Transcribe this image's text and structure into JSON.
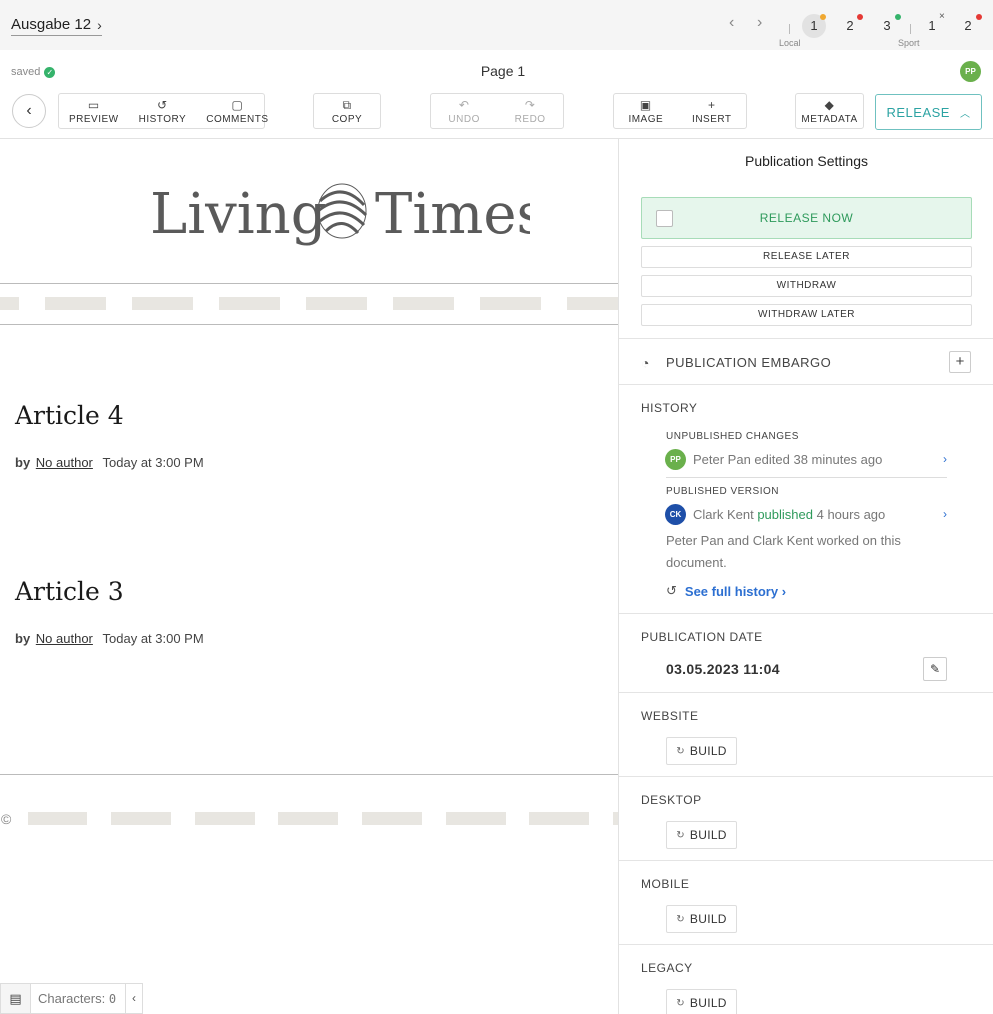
{
  "topbar": {
    "issue_label": "Ausgabe 12",
    "pages": [
      {
        "label": "1",
        "group": "Local",
        "status_color": "#f0a830",
        "active": true
      },
      {
        "label": "2",
        "group": "Local",
        "status_color": "#e53935"
      },
      {
        "label": "3",
        "group": "Sport",
        "status_color": "#35b36b"
      },
      {
        "label": "1",
        "group": "Sport",
        "status_mark": "×"
      },
      {
        "label": "2",
        "group": "Sport",
        "status_color": "#e53935"
      }
    ],
    "group_labels": [
      "Local",
      "Sport"
    ]
  },
  "subbar": {
    "saved_label": "saved",
    "page_title": "Page 1",
    "user_initials": "PP"
  },
  "toolbar": {
    "preview": "PREVIEW",
    "history": "HISTORY",
    "comments": "COMMENTS",
    "copy": "COPY",
    "undo": "UNDO",
    "redo": "REDO",
    "image": "IMAGE",
    "insert": "INSERT",
    "metadata": "METADATA",
    "release": "RELEASE"
  },
  "canvas": {
    "logo": "Living Times",
    "articles": [
      {
        "title": "Article 4",
        "by": "by",
        "author": "No author",
        "date": "Today at 3:00 PM"
      },
      {
        "title": "Article 3",
        "by": "by",
        "author": "No author",
        "date": "Today at 3:00 PM"
      }
    ],
    "footer_symbol": "©"
  },
  "charbar": {
    "label": "Characters:",
    "count": "0"
  },
  "panel": {
    "title": "Publication Settings",
    "release_now": "RELEASE NOW",
    "release_later": "RELEASE LATER",
    "withdraw": "WITHDRAW",
    "withdraw_later": "WITHDRAW LATER",
    "embargo": "PUBLICATION EMBARGO",
    "history": {
      "label": "HISTORY",
      "unpublished_label": "UNPUBLISHED CHANGES",
      "unpublished": {
        "initials": "PP",
        "avatar_color": "#6ab04c",
        "text": "Peter Pan edited 38 minutes ago"
      },
      "published_label": "PUBLISHED VERSION",
      "published": {
        "initials": "CK",
        "avatar_color": "#1e4fa8",
        "name": "Clark Kent",
        "action": "published",
        "when": "4 hours ago"
      },
      "worked": "Peter Pan and Clark Kent worked on this document.",
      "full_history": "See full history ›"
    },
    "publication_date_label": "PUBLICATION DATE",
    "publication_date": "03.05.2023 11:04",
    "channels": [
      {
        "label": "WEBSITE",
        "button": "BUILD"
      },
      {
        "label": "DESKTOP",
        "button": "BUILD"
      },
      {
        "label": "MOBILE",
        "button": "BUILD"
      },
      {
        "label": "LEGACY",
        "button": "BUILD"
      }
    ]
  }
}
